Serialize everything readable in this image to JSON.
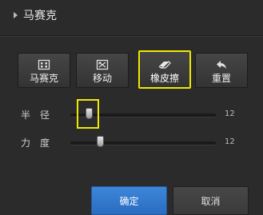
{
  "panel": {
    "title": "马赛克"
  },
  "tools": [
    {
      "label": "马赛克",
      "icon": "mosaic-icon",
      "active": false
    },
    {
      "label": "移动",
      "icon": "move-icon",
      "active": false
    },
    {
      "label": "橡皮擦",
      "icon": "eraser-icon",
      "active": true
    },
    {
      "label": "重置",
      "icon": "undo-arrow-icon",
      "active": false
    }
  ],
  "sliders": {
    "radius": {
      "label": "半径",
      "value": "12"
    },
    "strength": {
      "label": "力度",
      "value": "12"
    }
  },
  "buttons": {
    "confirm": "确定",
    "cancel": "取消"
  },
  "colors": {
    "background": "#2b2b2b",
    "highlight": "#f0e800",
    "primary_button": "#2f74c9"
  }
}
